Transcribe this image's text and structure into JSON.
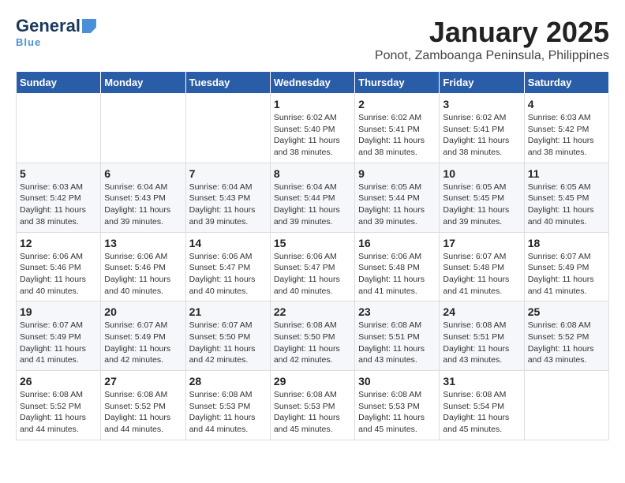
{
  "header": {
    "logo_general": "General",
    "logo_blue": "Blue",
    "title": "January 2025",
    "subtitle": "Ponot, Zamboanga Peninsula, Philippines"
  },
  "days_of_week": [
    "Sunday",
    "Monday",
    "Tuesday",
    "Wednesday",
    "Thursday",
    "Friday",
    "Saturday"
  ],
  "weeks": [
    [
      {
        "day": "",
        "info": ""
      },
      {
        "day": "",
        "info": ""
      },
      {
        "day": "",
        "info": ""
      },
      {
        "day": "1",
        "info": "Sunrise: 6:02 AM\nSunset: 5:40 PM\nDaylight: 11 hours and 38 minutes."
      },
      {
        "day": "2",
        "info": "Sunrise: 6:02 AM\nSunset: 5:41 PM\nDaylight: 11 hours and 38 minutes."
      },
      {
        "day": "3",
        "info": "Sunrise: 6:02 AM\nSunset: 5:41 PM\nDaylight: 11 hours and 38 minutes."
      },
      {
        "day": "4",
        "info": "Sunrise: 6:03 AM\nSunset: 5:42 PM\nDaylight: 11 hours and 38 minutes."
      }
    ],
    [
      {
        "day": "5",
        "info": "Sunrise: 6:03 AM\nSunset: 5:42 PM\nDaylight: 11 hours and 38 minutes."
      },
      {
        "day": "6",
        "info": "Sunrise: 6:04 AM\nSunset: 5:43 PM\nDaylight: 11 hours and 39 minutes."
      },
      {
        "day": "7",
        "info": "Sunrise: 6:04 AM\nSunset: 5:43 PM\nDaylight: 11 hours and 39 minutes."
      },
      {
        "day": "8",
        "info": "Sunrise: 6:04 AM\nSunset: 5:44 PM\nDaylight: 11 hours and 39 minutes."
      },
      {
        "day": "9",
        "info": "Sunrise: 6:05 AM\nSunset: 5:44 PM\nDaylight: 11 hours and 39 minutes."
      },
      {
        "day": "10",
        "info": "Sunrise: 6:05 AM\nSunset: 5:45 PM\nDaylight: 11 hours and 39 minutes."
      },
      {
        "day": "11",
        "info": "Sunrise: 6:05 AM\nSunset: 5:45 PM\nDaylight: 11 hours and 40 minutes."
      }
    ],
    [
      {
        "day": "12",
        "info": "Sunrise: 6:06 AM\nSunset: 5:46 PM\nDaylight: 11 hours and 40 minutes."
      },
      {
        "day": "13",
        "info": "Sunrise: 6:06 AM\nSunset: 5:46 PM\nDaylight: 11 hours and 40 minutes."
      },
      {
        "day": "14",
        "info": "Sunrise: 6:06 AM\nSunset: 5:47 PM\nDaylight: 11 hours and 40 minutes."
      },
      {
        "day": "15",
        "info": "Sunrise: 6:06 AM\nSunset: 5:47 PM\nDaylight: 11 hours and 40 minutes."
      },
      {
        "day": "16",
        "info": "Sunrise: 6:06 AM\nSunset: 5:48 PM\nDaylight: 11 hours and 41 minutes."
      },
      {
        "day": "17",
        "info": "Sunrise: 6:07 AM\nSunset: 5:48 PM\nDaylight: 11 hours and 41 minutes."
      },
      {
        "day": "18",
        "info": "Sunrise: 6:07 AM\nSunset: 5:49 PM\nDaylight: 11 hours and 41 minutes."
      }
    ],
    [
      {
        "day": "19",
        "info": "Sunrise: 6:07 AM\nSunset: 5:49 PM\nDaylight: 11 hours and 41 minutes."
      },
      {
        "day": "20",
        "info": "Sunrise: 6:07 AM\nSunset: 5:49 PM\nDaylight: 11 hours and 42 minutes."
      },
      {
        "day": "21",
        "info": "Sunrise: 6:07 AM\nSunset: 5:50 PM\nDaylight: 11 hours and 42 minutes."
      },
      {
        "day": "22",
        "info": "Sunrise: 6:08 AM\nSunset: 5:50 PM\nDaylight: 11 hours and 42 minutes."
      },
      {
        "day": "23",
        "info": "Sunrise: 6:08 AM\nSunset: 5:51 PM\nDaylight: 11 hours and 43 minutes."
      },
      {
        "day": "24",
        "info": "Sunrise: 6:08 AM\nSunset: 5:51 PM\nDaylight: 11 hours and 43 minutes."
      },
      {
        "day": "25",
        "info": "Sunrise: 6:08 AM\nSunset: 5:52 PM\nDaylight: 11 hours and 43 minutes."
      }
    ],
    [
      {
        "day": "26",
        "info": "Sunrise: 6:08 AM\nSunset: 5:52 PM\nDaylight: 11 hours and 44 minutes."
      },
      {
        "day": "27",
        "info": "Sunrise: 6:08 AM\nSunset: 5:52 PM\nDaylight: 11 hours and 44 minutes."
      },
      {
        "day": "28",
        "info": "Sunrise: 6:08 AM\nSunset: 5:53 PM\nDaylight: 11 hours and 44 minutes."
      },
      {
        "day": "29",
        "info": "Sunrise: 6:08 AM\nSunset: 5:53 PM\nDaylight: 11 hours and 45 minutes."
      },
      {
        "day": "30",
        "info": "Sunrise: 6:08 AM\nSunset: 5:53 PM\nDaylight: 11 hours and 45 minutes."
      },
      {
        "day": "31",
        "info": "Sunrise: 6:08 AM\nSunset: 5:54 PM\nDaylight: 11 hours and 45 minutes."
      },
      {
        "day": "",
        "info": ""
      }
    ]
  ]
}
